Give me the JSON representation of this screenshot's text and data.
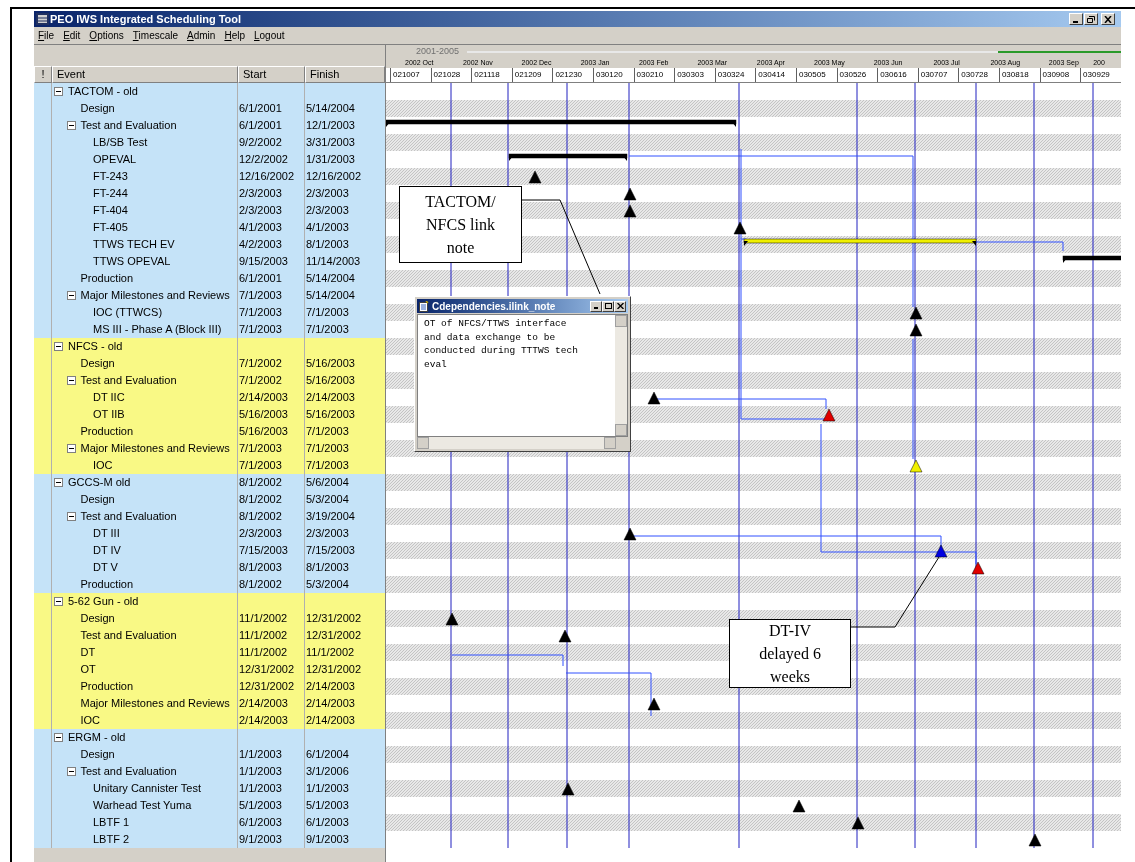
{
  "window": {
    "title": "PEO IWS Integrated Scheduling Tool"
  },
  "menu": [
    "File",
    "Edit",
    "Options",
    "Timescale",
    "Admin",
    "Help",
    "Logout"
  ],
  "columns": [
    "!",
    "Event",
    "Start",
    "Finish"
  ],
  "timescale": {
    "range": "2001-2005",
    "months": [
      "2002 Oct",
      "2002 Nov",
      "2002 Dec",
      "2003 Jan",
      "2003 Feb",
      "2003 Mar",
      "2003 Apr",
      "2003 May",
      "2003 Jun",
      "2003 Jul",
      "2003 Aug",
      "2003 Sep",
      "200"
    ],
    "dates": [
      "021007",
      "021028",
      "021118",
      "021209",
      "021230",
      "030120",
      "030210",
      "030303",
      "030324",
      "030414",
      "030505",
      "030526",
      "030616",
      "030707",
      "030728",
      "030818",
      "030908",
      "030929"
    ]
  },
  "groups": [
    {
      "name": "TACTOM - old",
      "color": "#c5e3f8",
      "expanded": true,
      "children": [
        {
          "name": "Design",
          "start": "6/1/2001",
          "finish": "5/14/2004"
        },
        {
          "name": "Test and Evaluation",
          "start": "6/1/2001",
          "finish": "12/1/2003",
          "expanded": true,
          "children": [
            {
              "name": "LB/SB Test",
              "start": "9/2/2002",
              "finish": "3/31/2003"
            },
            {
              "name": "OPEVAL",
              "start": "12/2/2002",
              "finish": "1/31/2003"
            },
            {
              "name": "FT-243",
              "start": "12/16/2002",
              "finish": "12/16/2002"
            },
            {
              "name": "FT-244",
              "start": "2/3/2003",
              "finish": "2/3/2003"
            },
            {
              "name": "FT-404",
              "start": "2/3/2003",
              "finish": "2/3/2003"
            },
            {
              "name": "FT-405",
              "start": "4/1/2003",
              "finish": "4/1/2003"
            },
            {
              "name": "TTWS TECH EV",
              "start": "4/2/2003",
              "finish": "8/1/2003"
            },
            {
              "name": "TTWS OPEVAL",
              "start": "9/15/2003",
              "finish": "11/14/2003"
            }
          ]
        },
        {
          "name": "Production",
          "start": "6/1/2001",
          "finish": "5/14/2004"
        },
        {
          "name": "Major Milestones and Reviews",
          "start": "7/1/2003",
          "finish": "5/14/2004",
          "expanded": true,
          "children": [
            {
              "name": "IOC (TTWCS)",
              "start": "7/1/2003",
              "finish": "7/1/2003"
            },
            {
              "name": "MS III - Phase A (Block III)",
              "start": "7/1/2003",
              "finish": "7/1/2003"
            }
          ]
        }
      ]
    },
    {
      "name": "NFCS - old",
      "color": "#f9f985",
      "expanded": true,
      "children": [
        {
          "name": "Design",
          "start": "7/1/2002",
          "finish": "5/16/2003"
        },
        {
          "name": "Test and Evaluation",
          "start": "7/1/2002",
          "finish": "5/16/2003",
          "expanded": true,
          "children": [
            {
              "name": "DT IIC",
              "start": "2/14/2003",
              "finish": "2/14/2003"
            },
            {
              "name": "OT IIB",
              "start": "5/16/2003",
              "finish": "5/16/2003"
            }
          ]
        },
        {
          "name": "Production",
          "start": "5/16/2003",
          "finish": "7/1/2003"
        },
        {
          "name": "Major Milestones and Reviews",
          "start": "7/1/2003",
          "finish": "7/1/2003",
          "expanded": true,
          "children": [
            {
              "name": "IOC",
              "start": "7/1/2003",
              "finish": "7/1/2003"
            }
          ]
        }
      ]
    },
    {
      "name": "GCCS-M old",
      "start": "8/1/2002",
      "finish": "5/6/2004",
      "color": "#c5e3f8",
      "expanded": true,
      "children": [
        {
          "name": "Design",
          "start": "8/1/2002",
          "finish": "5/3/2004"
        },
        {
          "name": "Test and Evaluation",
          "start": "8/1/2002",
          "finish": "3/19/2004",
          "expanded": true,
          "children": [
            {
              "name": "DT III",
              "start": "2/3/2003",
              "finish": "2/3/2003"
            },
            {
              "name": "DT IV",
              "start": "7/15/2003",
              "finish": "7/15/2003"
            },
            {
              "name": "DT V",
              "start": "8/1/2003",
              "finish": "8/1/2003"
            }
          ]
        },
        {
          "name": "Production",
          "start": "8/1/2002",
          "finish": "5/3/2004"
        }
      ]
    },
    {
      "name": "5-62 Gun - old",
      "color": "#f9f985",
      "expanded": true,
      "children": [
        {
          "name": "Design",
          "start": "11/1/2002",
          "finish": "12/31/2002"
        },
        {
          "name": "Test and Evaluation",
          "start": "11/1/2002",
          "finish": "12/31/2002"
        },
        {
          "name": "DT",
          "start": "11/1/2002",
          "finish": "11/1/2002"
        },
        {
          "name": "OT",
          "start": "12/31/2002",
          "finish": "12/31/2002"
        },
        {
          "name": "Production",
          "start": "12/31/2002",
          "finish": "2/14/2003"
        },
        {
          "name": "Major Milestones and Reviews",
          "start": "2/14/2003",
          "finish": "2/14/2003"
        },
        {
          "name": "IOC",
          "start": "2/14/2003",
          "finish": "2/14/2003"
        }
      ]
    },
    {
      "name": "ERGM - old",
      "color": "#c5e3f8",
      "expanded": true,
      "children": [
        {
          "name": "Design",
          "start": "1/1/2003",
          "finish": "6/1/2004"
        },
        {
          "name": "Test and Evaluation",
          "start": "1/1/2003",
          "finish": "3/1/2006",
          "expanded": true,
          "children": [
            {
              "name": "Unitary Cannister Test",
              "start": "1/1/2003",
              "finish": "1/1/2003"
            },
            {
              "name": "Warhead Test Yuma",
              "start": "5/1/2003",
              "finish": "5/1/2003"
            },
            {
              "name": "LBTF 1",
              "start": "6/1/2003",
              "finish": "6/1/2003"
            },
            {
              "name": "LBTF 2",
              "start": "9/1/2003",
              "finish": "9/1/2003"
            }
          ]
        }
      ]
    }
  ],
  "note_window": {
    "title": "Cdependencies.ilink_note",
    "lines": [
      "OT of NFCS/TTWS interface",
      "and data exchange to be",
      "conducted during TTTWS tech",
      "eval"
    ]
  },
  "callouts": [
    {
      "lines": [
        "TACTOM/",
        "NFCS link",
        "note"
      ]
    },
    {
      "lines": [
        "DT-IV",
        "delayed 6",
        "weeks"
      ]
    }
  ]
}
